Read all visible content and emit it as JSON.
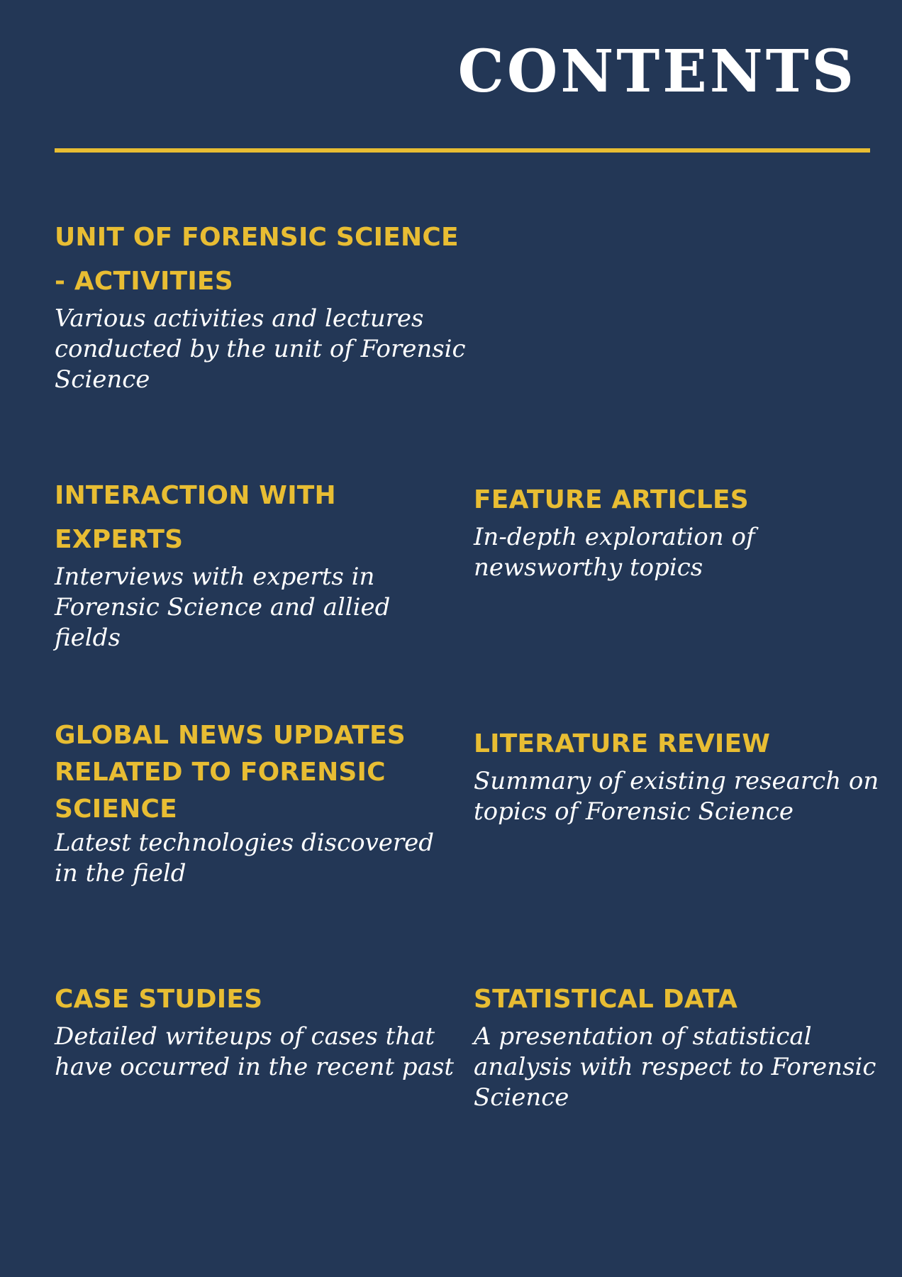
{
  "page": {
    "title": "CONTENTS",
    "colors": {
      "background": "#233756",
      "accent": "#e8bd33",
      "text": "#ffffff"
    }
  },
  "items": [
    {
      "heading": "UNIT OF FORENSIC SCIENCE\n - ACTIVITIES",
      "description": "Various activities and lectures\nconducted by the unit of Forensic\nScience"
    },
    {
      "heading": "INTERACTION WITH\nEXPERTS",
      "description": "Interviews with experts in\nForensic Science and allied fields"
    },
    {
      "heading": "FEATURE ARTICLES",
      "description": "In-depth exploration of\nnewsworthy topics"
    },
    {
      "heading": "GLOBAL NEWS UPDATES\nRELATED TO FORENSIC\nSCIENCE",
      "description": "Latest technologies discovered\nin the field"
    },
    {
      "heading": "LITERATURE REVIEW",
      "description": "Summary of existing research on\ntopics of Forensic Science"
    },
    {
      "heading": "CASE STUDIES",
      "description": "Detailed writeups of cases that\nhave occurred in the recent past"
    },
    {
      "heading": "STATISTICAL DATA",
      "description": "A presentation of statistical\nanalysis with respect to Forensic\nScience"
    }
  ]
}
